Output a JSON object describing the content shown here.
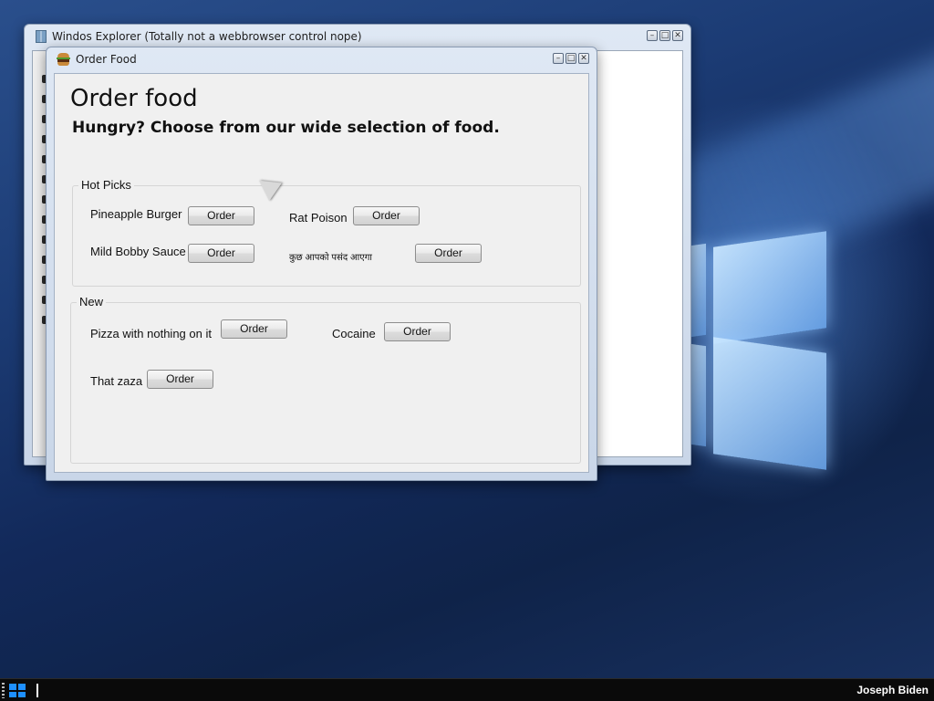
{
  "explorer": {
    "title": "Windos Explorer (Totally not a webbrowser control nope)",
    "controls": {
      "minimize": "–",
      "maximize": "□",
      "close": "✕"
    }
  },
  "order_window": {
    "title": "Order Food",
    "heading": "Order food",
    "subheading": "Hungry? Choose from our wide selection of food.",
    "controls": {
      "minimize": "–",
      "maximize": "□",
      "close": "✕"
    },
    "groups": [
      {
        "legend": "Hot Picks",
        "items": [
          {
            "label": "Pineapple Burger",
            "button": "Order"
          },
          {
            "label": "Rat Poison",
            "button": "Order"
          },
          {
            "label": "Mild Bobby Sauce",
            "button": "Order"
          },
          {
            "label": "कुछ आपको पसंद आएगा",
            "button": "Order"
          }
        ]
      },
      {
        "legend": "New",
        "items": [
          {
            "label": "Pizza with nothing on it",
            "button": "Order"
          },
          {
            "label": "Cocaine",
            "button": "Order"
          },
          {
            "label": "That zaza",
            "button": "Order"
          }
        ]
      }
    ]
  },
  "taskbar": {
    "start_icon": "windows-logo-icon",
    "user": "Joseph Biden"
  }
}
